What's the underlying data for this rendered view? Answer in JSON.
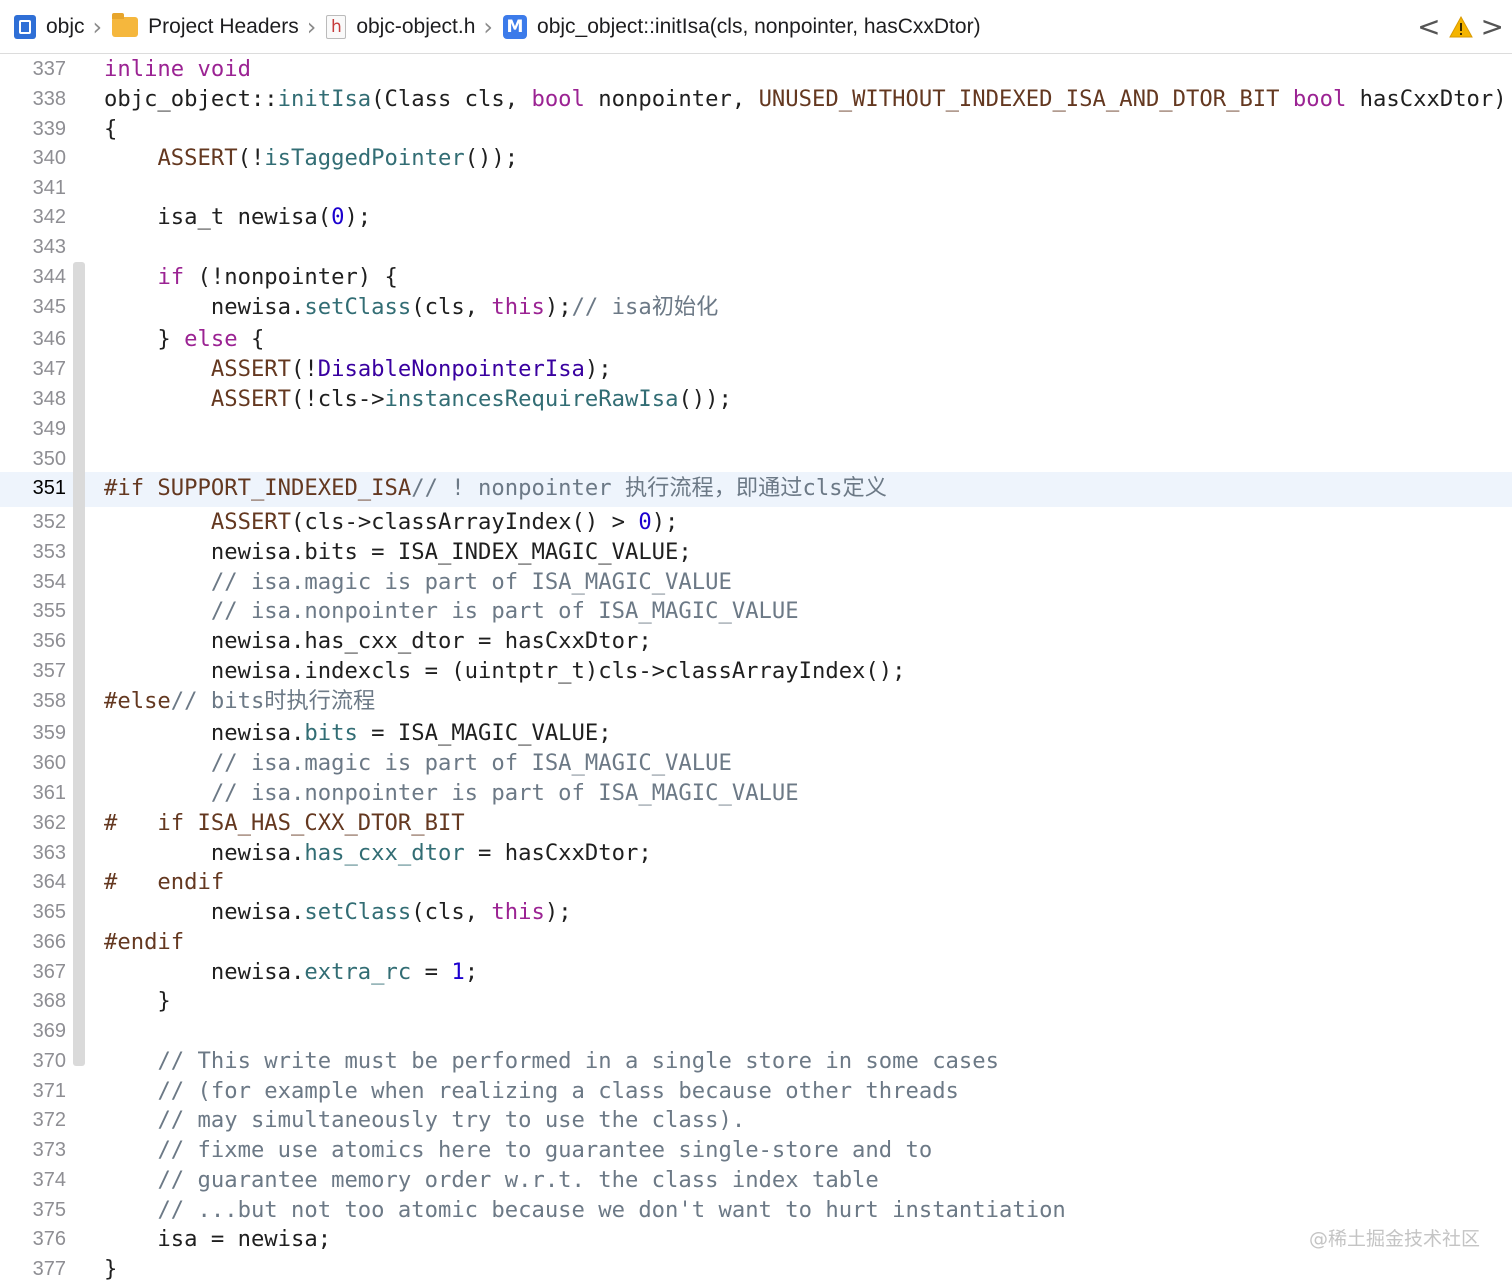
{
  "breadcrumb": [
    {
      "label": "objc",
      "icon": "project-icon"
    },
    {
      "label": "Project Headers",
      "icon": "folder-icon"
    },
    {
      "label": "objc-object.h",
      "icon": "header-file-icon",
      "icon_text": "h"
    },
    {
      "label": "objc_object::initIsa(cls, nonpointer, hasCxxDtor)",
      "icon": "method-icon",
      "icon_text": "M"
    }
  ],
  "nav": {
    "back": "<",
    "forward": ">",
    "warning_icon": "warning-icon"
  },
  "editor": {
    "current_line": "351",
    "lines": [
      {
        "n": "337",
        "code": "inline void"
      },
      {
        "n": "338",
        "code": "objc_object::initIsa(Class cls, bool nonpointer, UNUSED_WITHOUT_INDEXED_ISA_AND_DTOR_BIT bool hasCxxDtor)"
      },
      {
        "n": "339",
        "code": "{"
      },
      {
        "n": "340",
        "code": "    ASSERT(!isTaggedPointer());"
      },
      {
        "n": "341",
        "code": ""
      },
      {
        "n": "342",
        "code": "    isa_t newisa(0);"
      },
      {
        "n": "343",
        "code": ""
      },
      {
        "n": "344",
        "code": "    if (!nonpointer) {"
      },
      {
        "n": "345",
        "code": "        newisa.setClass(cls, this);// isa初始化"
      },
      {
        "n": "346",
        "code": "    } else {"
      },
      {
        "n": "347",
        "code": "        ASSERT(!DisableNonpointerIsa);"
      },
      {
        "n": "348",
        "code": "        ASSERT(!cls->instancesRequireRawIsa());"
      },
      {
        "n": "349",
        "code": ""
      },
      {
        "n": "350",
        "code": ""
      },
      {
        "n": "351",
        "code": "#if SUPPORT_INDEXED_ISA// ! nonpointer 执行流程，即通过cls定义"
      },
      {
        "n": "352",
        "code": "        ASSERT(cls->classArrayIndex() > 0);"
      },
      {
        "n": "353",
        "code": "        newisa.bits = ISA_INDEX_MAGIC_VALUE;"
      },
      {
        "n": "354",
        "code": "        // isa.magic is part of ISA_MAGIC_VALUE"
      },
      {
        "n": "355",
        "code": "        // isa.nonpointer is part of ISA_MAGIC_VALUE"
      },
      {
        "n": "356",
        "code": "        newisa.has_cxx_dtor = hasCxxDtor;"
      },
      {
        "n": "357",
        "code": "        newisa.indexcls = (uintptr_t)cls->classArrayIndex();"
      },
      {
        "n": "358",
        "code": "#else// bits时执行流程"
      },
      {
        "n": "359",
        "code": "        newisa.bits = ISA_MAGIC_VALUE;"
      },
      {
        "n": "360",
        "code": "        // isa.magic is part of ISA_MAGIC_VALUE"
      },
      {
        "n": "361",
        "code": "        // isa.nonpointer is part of ISA_MAGIC_VALUE"
      },
      {
        "n": "362",
        "code": "#   if ISA_HAS_CXX_DTOR_BIT"
      },
      {
        "n": "363",
        "code": "        newisa.has_cxx_dtor = hasCxxDtor;"
      },
      {
        "n": "364",
        "code": "#   endif"
      },
      {
        "n": "365",
        "code": "        newisa.setClass(cls, this);"
      },
      {
        "n": "366",
        "code": "#endif"
      },
      {
        "n": "367",
        "code": "        newisa.extra_rc = 1;"
      },
      {
        "n": "368",
        "code": "    }"
      },
      {
        "n": "369",
        "code": ""
      },
      {
        "n": "370",
        "code": "    // This write must be performed in a single store in some cases"
      },
      {
        "n": "371",
        "code": "    // (for example when realizing a class because other threads"
      },
      {
        "n": "372",
        "code": "    // may simultaneously try to use the class)."
      },
      {
        "n": "373",
        "code": "    // fixme use atomics here to guarantee single-store and to"
      },
      {
        "n": "374",
        "code": "    // guarantee memory order w.r.t. the class index table"
      },
      {
        "n": "375",
        "code": "    // ...but not too atomic because we don't want to hurt instantiation"
      },
      {
        "n": "376",
        "code": "    isa = newisa;"
      },
      {
        "n": "377",
        "code": "}"
      }
    ]
  },
  "watermark": "@稀土掘金技术社区"
}
